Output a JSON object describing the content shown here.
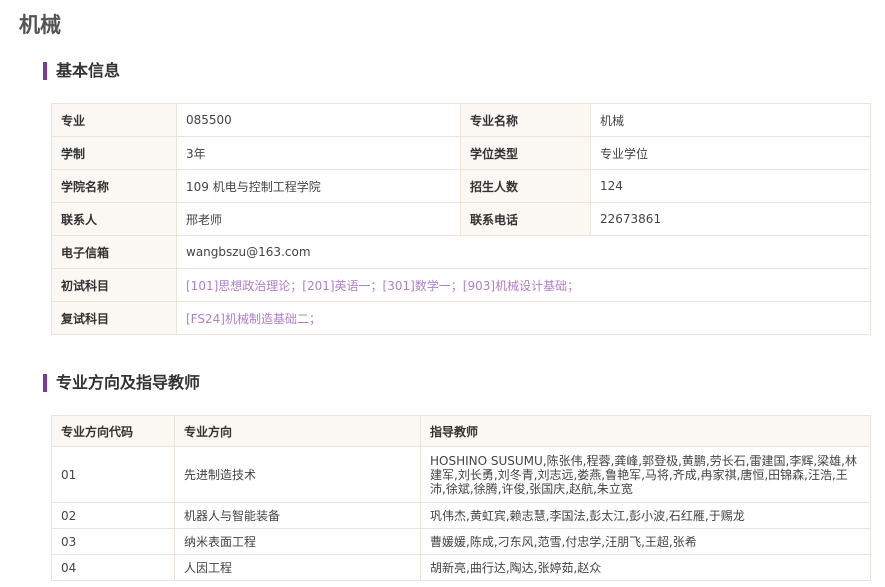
{
  "page_title": "机械",
  "basic_info": {
    "section_title": "基本信息",
    "rows": [
      {
        "l1": "专业",
        "v1": "085500",
        "l2": "专业名称",
        "v2": "机械"
      },
      {
        "l1": "学制",
        "v1": "3年",
        "l2": "学位类型",
        "v2": "专业学位"
      },
      {
        "l1": "学院名称",
        "v1": "109 机电与控制工程学院",
        "l2": "招生人数",
        "v2": "124"
      },
      {
        "l1": "联系人",
        "v1": "邢老师",
        "l2": "联系电话",
        "v2": "22673861"
      }
    ],
    "email_label": "电子信箱",
    "email": "wangbszu@163.com",
    "initial_exam_label": "初试科目",
    "initial_exam": "[101]思想政治理论；[201]英语一；[301]数学一；[903]机械设计基础；",
    "retest_label": "复试科目",
    "retest": "[FS24]机械制造基础二；",
    "accent_color": "#b07fc8"
  },
  "directions": {
    "section_title": "专业方向及指导教师",
    "headers": [
      "专业方向代码",
      "专业方向",
      "指导教师"
    ],
    "rows": [
      {
        "code": "01",
        "name": "先进制造技术",
        "teachers": "HOSHINO SUSUMU,陈张伟,程蓉,龚峰,郭登极,黄鹏,劳长石,雷建国,李辉,梁雄,林建军,刘长勇,刘冬青,刘志远,娄燕,鲁艳军,马将,齐成,冉家祺,唐恒,田锦森,汪浩,王沛,徐斌,徐腾,许俊,张国庆,赵航,朱立宽"
      },
      {
        "code": "02",
        "name": "机器人与智能装备",
        "teachers": "巩伟杰,黄虹宾,赖志慧,李国法,彭太江,彭小波,石红雁,于赐龙"
      },
      {
        "code": "03",
        "name": "纳米表面工程",
        "teachers": "曹媛媛,陈成,刁东风,范雪,付忠学,汪朋飞,王超,张希"
      },
      {
        "code": "04",
        "name": "人因工程",
        "teachers": "胡新亮,曲行达,陶达,张婷茹,赵众"
      }
    ]
  }
}
